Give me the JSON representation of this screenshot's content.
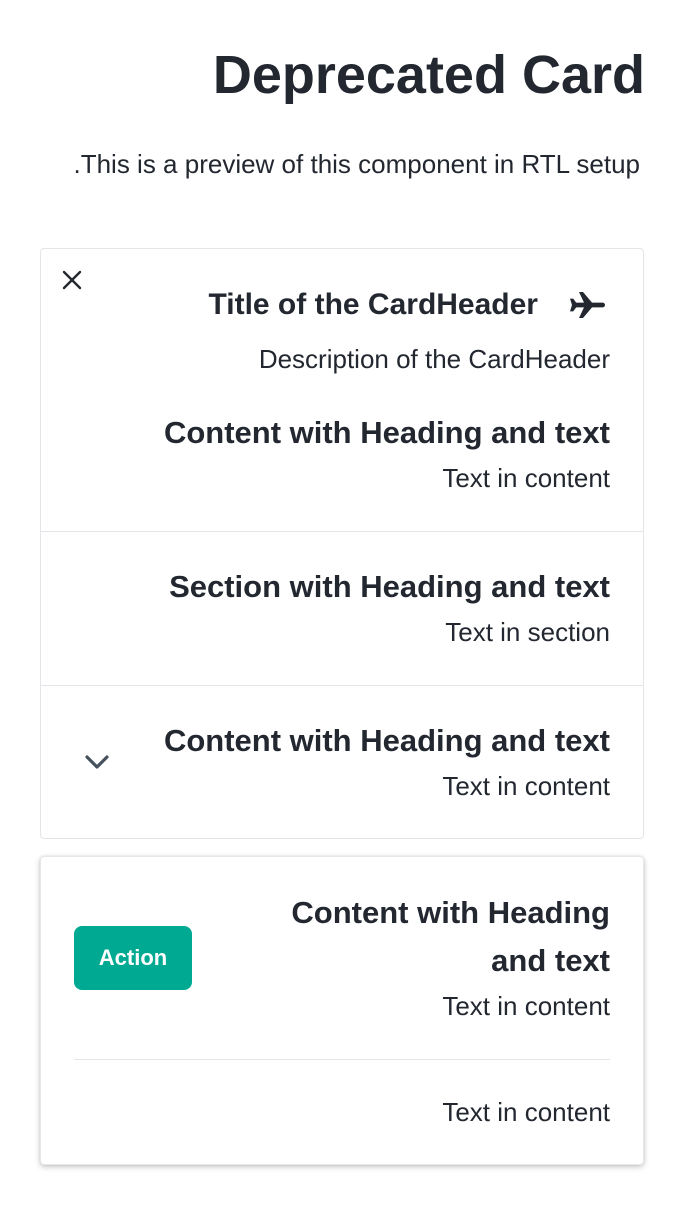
{
  "page": {
    "title": "Deprecated Card",
    "description": "This is a preview of this component in RTL setup."
  },
  "card1": {
    "header": {
      "title": "Title of the CardHeader",
      "description": "Description of the CardHeader",
      "icon": "airplane-icon",
      "close_icon": "close-icon"
    },
    "content": {
      "heading": "Content with Heading and text",
      "text": "Text in content"
    },
    "section": {
      "heading": "Section with Heading and text",
      "text": "Text in section"
    },
    "expandable": {
      "heading": "Content with Heading and text",
      "text": "Text in content",
      "icon": "chevron-down-icon"
    }
  },
  "card2": {
    "content": {
      "heading": "Content with Heading and text",
      "text": "Text in content",
      "action_label": "Action"
    },
    "footer_text": "Text in content"
  },
  "colors": {
    "text": "#222730",
    "border": "#e3e5e8",
    "action_button": "#00a991",
    "chevron": "#46515e"
  }
}
